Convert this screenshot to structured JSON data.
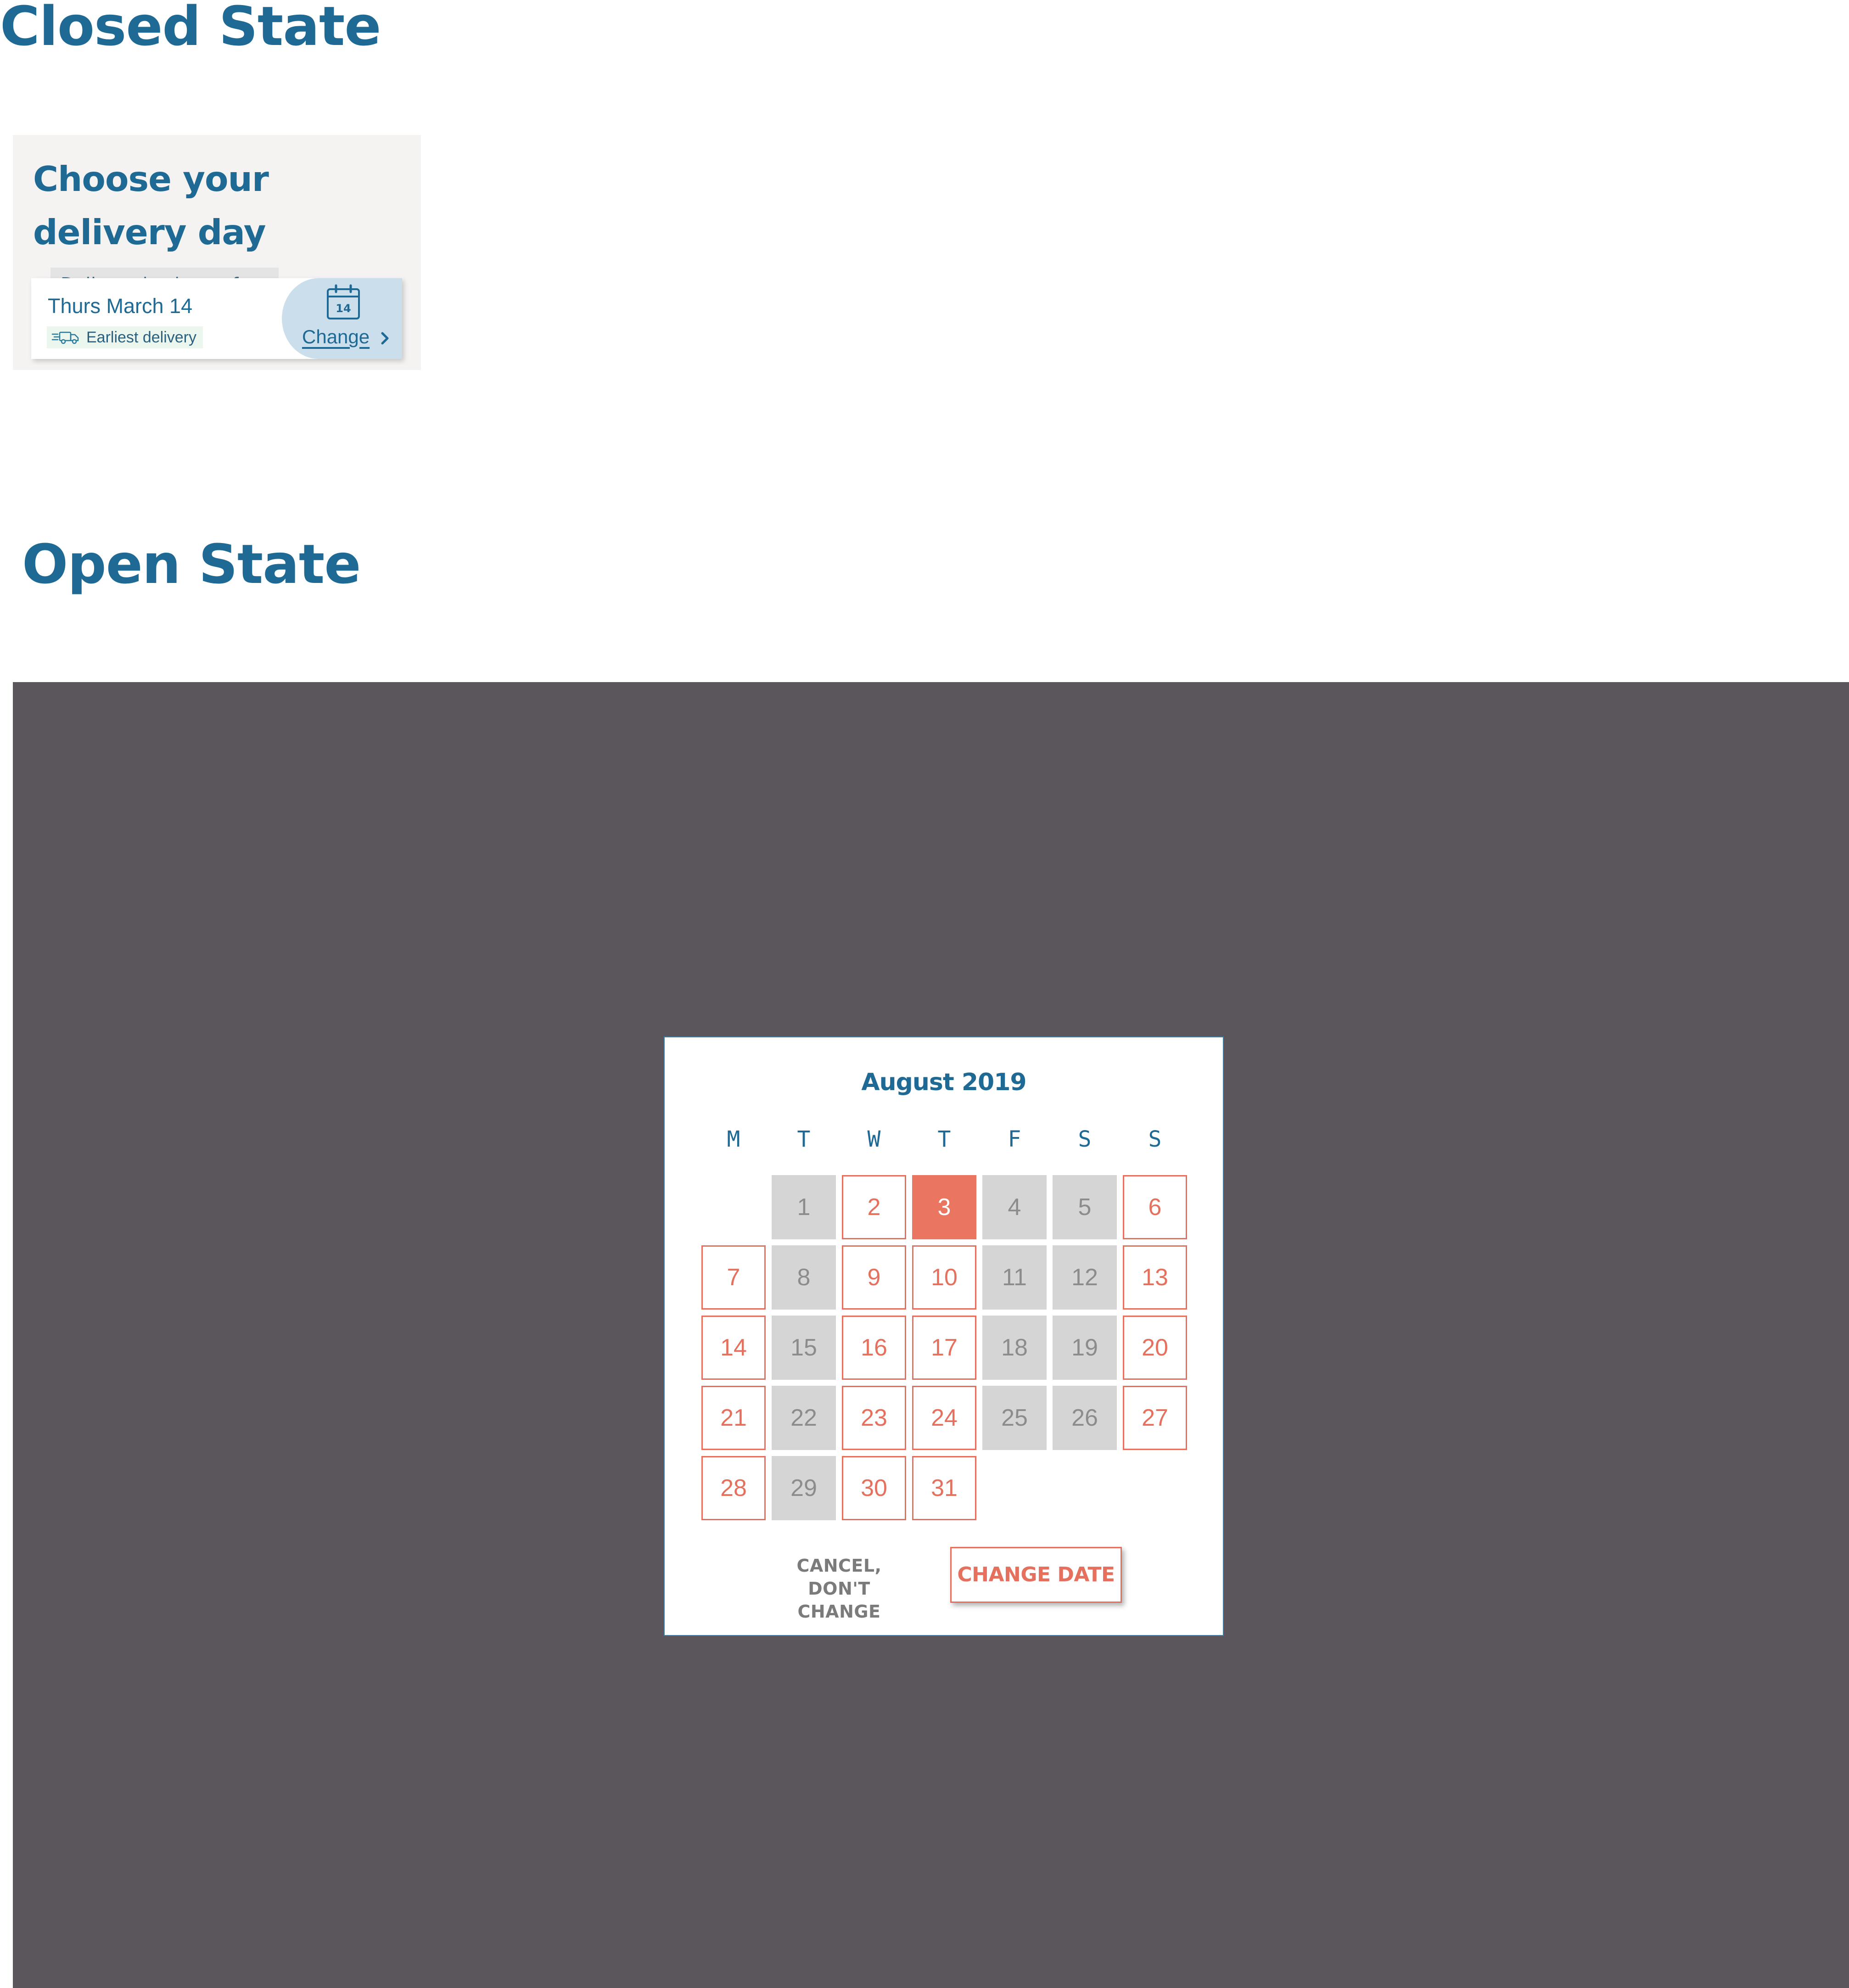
{
  "closed_state": {
    "heading": "Closed State",
    "card_title": "Choose your delivery day",
    "free_badge": "Delivery is always free",
    "selected_date": "Thurs March 14",
    "earliest_label": "Earliest delivery",
    "calendar_icon_day": "14",
    "change_label": "Change",
    "icons": {
      "truck": "delivery-truck-icon",
      "calendar": "calendar-icon",
      "chevron": "chevron-right-icon"
    }
  },
  "open_state": {
    "heading": "Open State",
    "month_title": "August 2019",
    "weekdays": [
      "M",
      "T",
      "W",
      "T",
      "F",
      "S",
      "S"
    ],
    "first_day_column": 1,
    "days": [
      {
        "day": "1",
        "status": "unavailable"
      },
      {
        "day": "2",
        "status": "available"
      },
      {
        "day": "3",
        "status": "selected"
      },
      {
        "day": "4",
        "status": "unavailable"
      },
      {
        "day": "5",
        "status": "unavailable"
      },
      {
        "day": "6",
        "status": "available"
      },
      {
        "day": "7",
        "status": "available"
      },
      {
        "day": "8",
        "status": "unavailable"
      },
      {
        "day": "9",
        "status": "available"
      },
      {
        "day": "10",
        "status": "available"
      },
      {
        "day": "11",
        "status": "unavailable"
      },
      {
        "day": "12",
        "status": "unavailable"
      },
      {
        "day": "13",
        "status": "available"
      },
      {
        "day": "14",
        "status": "available"
      },
      {
        "day": "15",
        "status": "unavailable"
      },
      {
        "day": "16",
        "status": "available"
      },
      {
        "day": "17",
        "status": "available"
      },
      {
        "day": "18",
        "status": "unavailable"
      },
      {
        "day": "19",
        "status": "unavailable"
      },
      {
        "day": "20",
        "status": "available"
      },
      {
        "day": "21",
        "status": "available"
      },
      {
        "day": "22",
        "status": "unavailable"
      },
      {
        "day": "23",
        "status": "available"
      },
      {
        "day": "24",
        "status": "available"
      },
      {
        "day": "25",
        "status": "unavailable"
      },
      {
        "day": "26",
        "status": "unavailable"
      },
      {
        "day": "27",
        "status": "available"
      },
      {
        "day": "28",
        "status": "available"
      },
      {
        "day": "29",
        "status": "unavailable"
      },
      {
        "day": "30",
        "status": "available"
      },
      {
        "day": "31",
        "status": "available"
      }
    ],
    "cancel_line1": "CANCEL,",
    "cancel_line2": "DON'T CHANGE",
    "confirm_label": "CHANGE DATE"
  },
  "colors": {
    "brand_blue": "#1e6a94",
    "accent_coral": "#e5705d",
    "selected_coral": "#ea7560",
    "unavailable_gray": "#d5d5d5",
    "overlay": "#5b565c",
    "panel_bg": "#f4f3f2",
    "change_area_bg": "#cadeec"
  }
}
